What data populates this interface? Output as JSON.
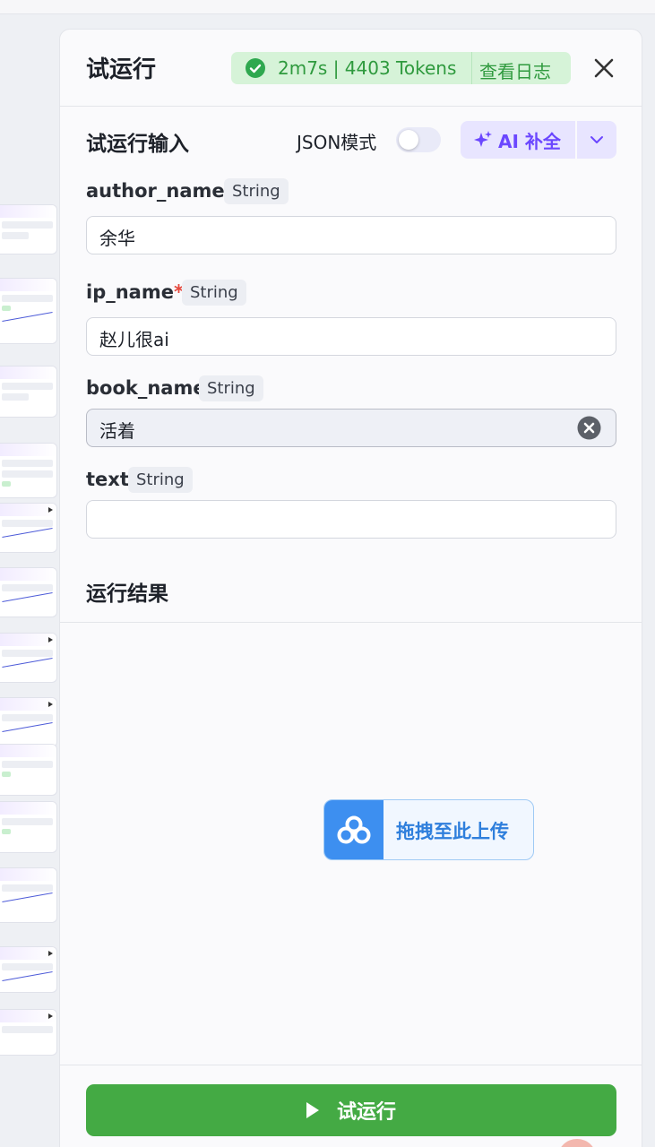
{
  "header": {
    "title": "试运行",
    "stats": "2m7s | 4403 Tokens",
    "logs_label": "查看日志"
  },
  "input_section": {
    "title": "试运行输入",
    "json_mode_label": "JSON模式",
    "json_mode_on": false,
    "ai_button_label": "AI 补全"
  },
  "fields": [
    {
      "name": "author_name",
      "required_mark": "*",
      "type": "String",
      "value": "余华"
    },
    {
      "name": "ip_name",
      "required_mark": "*",
      "type": "String",
      "value": "赵儿很ai"
    },
    {
      "name": "book_name",
      "required_mark": "",
      "type": "String",
      "value": "活着"
    },
    {
      "name": "text",
      "required_mark": "",
      "type": "String",
      "value": ""
    }
  ],
  "result_section": {
    "title": "运行结果"
  },
  "upload": {
    "label": "拖拽至此上传"
  },
  "run_button": {
    "label": "试运行"
  },
  "colors": {
    "accent_green": "#44aa44",
    "status_green": "#2f9a3e",
    "ai_purple": "#6b47ff",
    "upload_blue": "#3d8ff0"
  }
}
